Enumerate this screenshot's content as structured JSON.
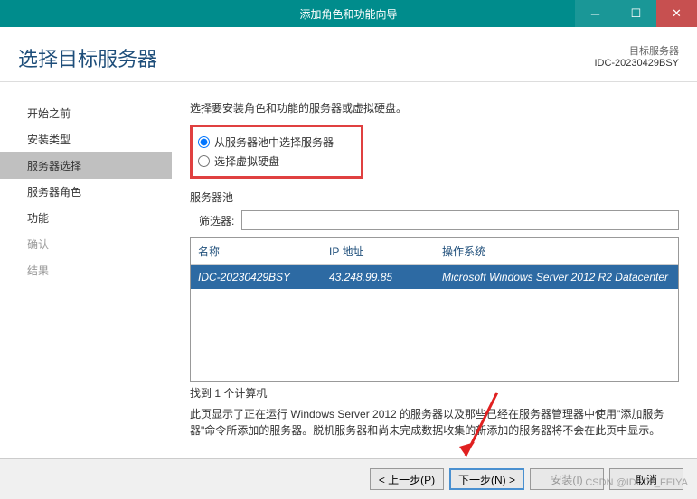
{
  "window": {
    "title": "添加角色和功能向导"
  },
  "header": {
    "page_title": "选择目标服务器",
    "target_label": "目标服务器",
    "target_name": "IDC-20230429BSY"
  },
  "sidebar": {
    "items": [
      {
        "label": "开始之前",
        "state": "normal"
      },
      {
        "label": "安装类型",
        "state": "normal"
      },
      {
        "label": "服务器选择",
        "state": "active"
      },
      {
        "label": "服务器角色",
        "state": "normal"
      },
      {
        "label": "功能",
        "state": "normal"
      },
      {
        "label": "确认",
        "state": "disabled"
      },
      {
        "label": "结果",
        "state": "disabled"
      }
    ]
  },
  "content": {
    "instruction": "选择要安装角色和功能的服务器或虚拟硬盘。",
    "radio_options": [
      {
        "label": "从服务器池中选择服务器",
        "checked": true
      },
      {
        "label": "选择虚拟硬盘",
        "checked": false
      }
    ],
    "pool_label": "服务器池",
    "filter_label": "筛选器:",
    "filter_value": "",
    "table": {
      "headers": {
        "name": "名称",
        "ip": "IP 地址",
        "os": "操作系统"
      },
      "rows": [
        {
          "name": "IDC-20230429BSY",
          "ip": "43.248.99.85",
          "os": "Microsoft Windows Server 2012 R2 Datacenter",
          "selected": true
        }
      ]
    },
    "count_text": "找到 1 个计算机",
    "description": "此页显示了正在运行 Windows Server 2012 的服务器以及那些已经在服务器管理器中使用\"添加服务器\"命令所添加的服务器。脱机服务器和尚未完成数据收集的新添加的服务器将不会在此页中显示。"
  },
  "footer": {
    "prev": "< 上一步(P)",
    "next": "下一步(N) >",
    "install": "安装(I)",
    "cancel": "取消"
  },
  "watermark": "CSDN @IDC02_FEIYA"
}
